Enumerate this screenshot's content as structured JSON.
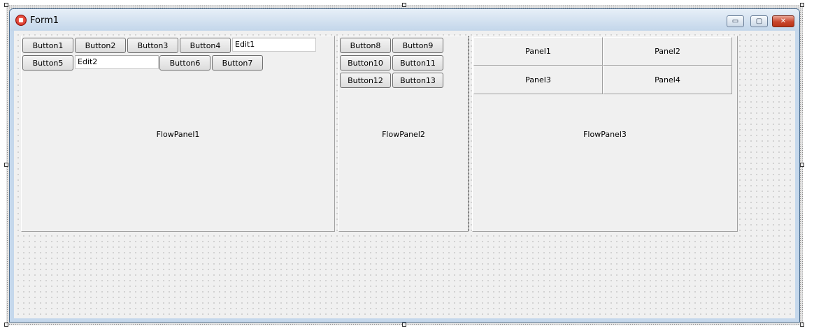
{
  "window": {
    "title": "Form1",
    "caption_buttons": {
      "minimize": "▭",
      "maximize": "▢",
      "close": "✕"
    }
  },
  "flowpanel1": {
    "caption": "FlowPanel1",
    "buttons": [
      "Button1",
      "Button2",
      "Button3",
      "Button4",
      "Button5",
      "Button6",
      "Button7"
    ],
    "edit1": "Edit1",
    "edit2": "Edit2"
  },
  "flowpanel2": {
    "caption": "FlowPanel2",
    "buttons": [
      "Button8",
      "Button9",
      "Button10",
      "Button11",
      "Button12",
      "Button13"
    ]
  },
  "flowpanel3": {
    "caption": "FlowPanel3",
    "panels": [
      "Panel1",
      "Panel2",
      "Panel3",
      "Panel4"
    ]
  },
  "colors": {
    "titlebar_top": "#e7eff8",
    "titlebar_bottom": "#c3d6ea",
    "client_bg": "#f0f0f0",
    "close_button": "#c9442b"
  },
  "icons": {
    "app": "app-icon",
    "minimize": "minimize-icon",
    "maximize": "maximize-icon",
    "close": "close-icon"
  }
}
